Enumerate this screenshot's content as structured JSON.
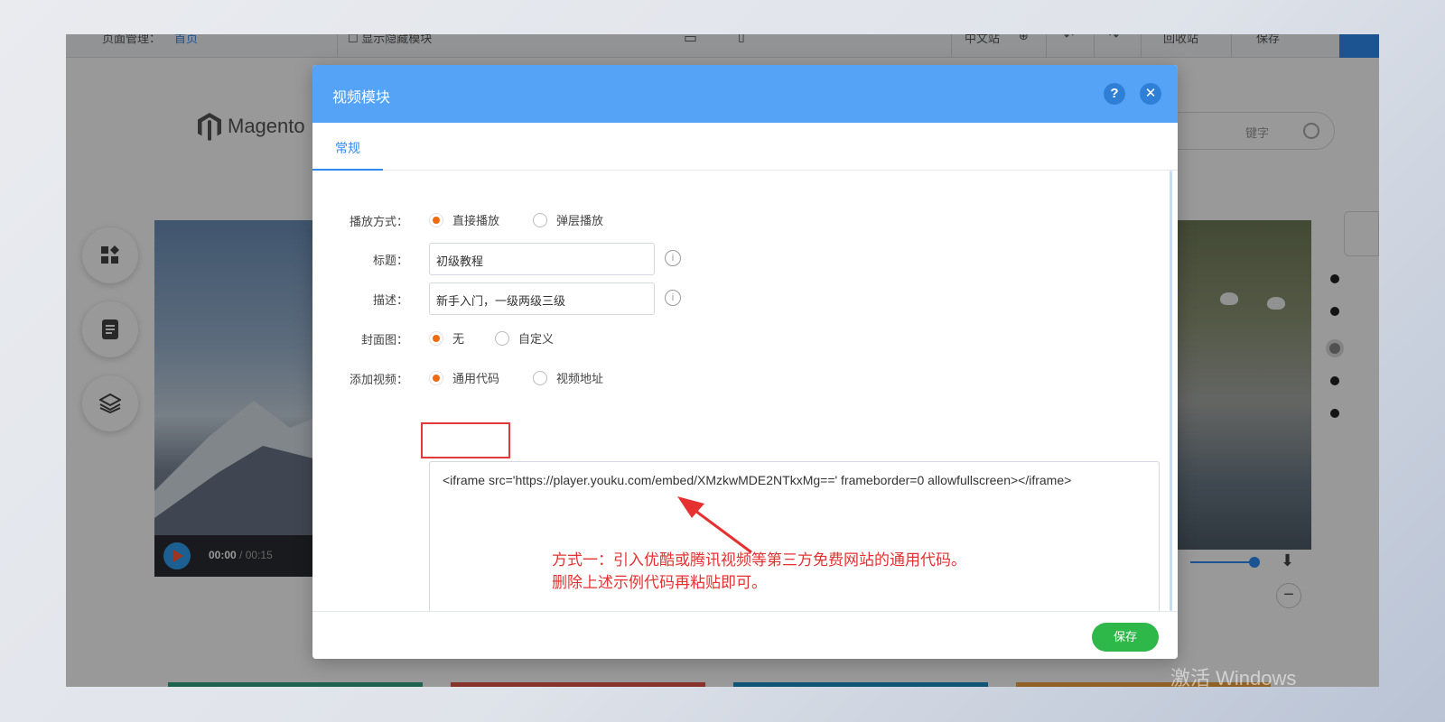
{
  "topbar": {
    "page_manage": "页面管理：",
    "page_select": "首页",
    "show_hidden": "显示隐藏模块",
    "lang": "中文站",
    "recycle": "回收站",
    "operate": "保存"
  },
  "background_page": {
    "logo_text": "Magento",
    "search_placeholder": "键字",
    "video_time_current": "00:00",
    "video_time_sep": " / ",
    "video_time_total": "00:15",
    "watermark": "激活 Windows"
  },
  "colors": {
    "header_blue": "#54a3f7",
    "tab_blue": "#2d8cf0",
    "radio_orange": "#ef6a13",
    "save_green": "#2eb84a",
    "annotation_red": "#e63131"
  },
  "modal": {
    "title": "视频模块",
    "help_icon": "?",
    "close_icon": "✕",
    "tab_general": "常规",
    "play_mode": {
      "label": "播放方式：",
      "options": [
        "直接播放",
        "弹层播放"
      ],
      "selected": "直接播放"
    },
    "title_field": {
      "label": "标题：",
      "value": "初级教程"
    },
    "desc_field": {
      "label": "描述：",
      "value": "新手入门，一级两级三级"
    },
    "cover": {
      "label": "封面图：",
      "options": [
        "无",
        "自定义"
      ],
      "selected": "无"
    },
    "add_video": {
      "label": "添加视频：",
      "options": [
        "通用代码",
        "视频地址"
      ],
      "selected": "通用代码"
    },
    "code_value": "<iframe src='https://player.youku.com/embed/XMzkwMDE2NTkxMg==' frameborder=0 allowfullscreen></iframe>",
    "annotation_line1": "方式一：引入优酷或腾讯视频等第三方免费网站的通用代码。",
    "annotation_line2": "删除上述示例代码再粘贴即可。",
    "save_label": "保存"
  }
}
